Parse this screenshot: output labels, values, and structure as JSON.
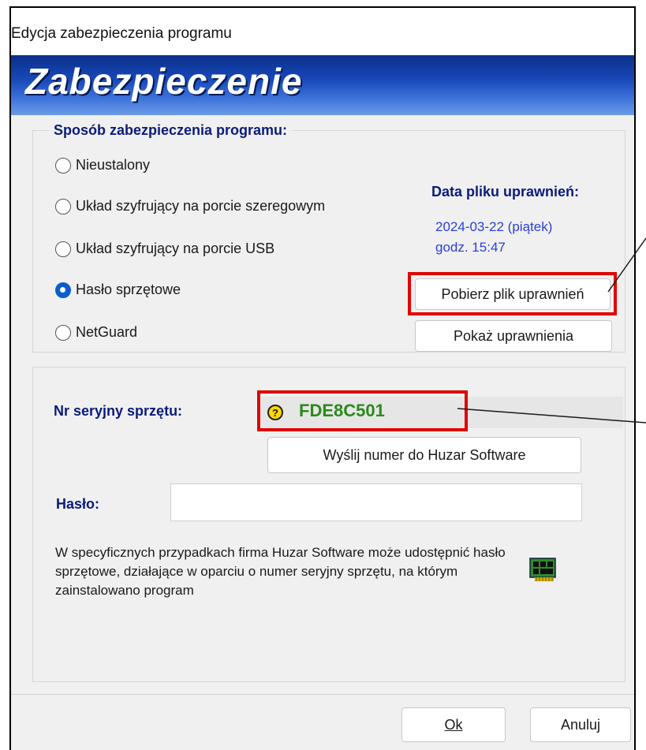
{
  "window": {
    "title": "Edycja zabezpieczenia programu"
  },
  "banner": {
    "title": "Zabezpieczenie"
  },
  "method_group": {
    "legend": "Sposób zabezpieczenia programu:",
    "options": [
      {
        "label": "Nieustalony",
        "checked": false
      },
      {
        "label": "Układ szyfrujący na porcie szeregowym",
        "checked": false
      },
      {
        "label": "Układ szyfrujący na porcie USB",
        "checked": false
      },
      {
        "label": "Hasło sprzętowe",
        "checked": true
      },
      {
        "label": "NetGuard",
        "checked": false
      }
    ]
  },
  "permissions": {
    "title": "Data pliku uprawnień:",
    "date": "2024-03-22 (piątek)",
    "time": "godz. 15:47",
    "download_button": "Pobierz plik uprawnień",
    "show_button": "Pokaż uprawnienia"
  },
  "hardware": {
    "serial_label": "Nr seryjny sprzętu:",
    "serial_value": "FDE8C501",
    "send_button": "Wyślij numer do Huzar Software",
    "password_label": "Hasło:",
    "password_value": "",
    "info_text": "W specyficznych przypadkach firma Huzar Software może udostępnić hasło sprzętowe, działające w oparciu o numer seryjny sprzętu, na którym zainstalowano program"
  },
  "footer": {
    "ok_label": "Ok",
    "cancel_label": "Anuluj"
  },
  "colors": {
    "accent_blue": "#0a1c7a",
    "link_blue": "#2b3fd6",
    "serial_green": "#2a8a1a",
    "highlight_red": "#e00000"
  }
}
